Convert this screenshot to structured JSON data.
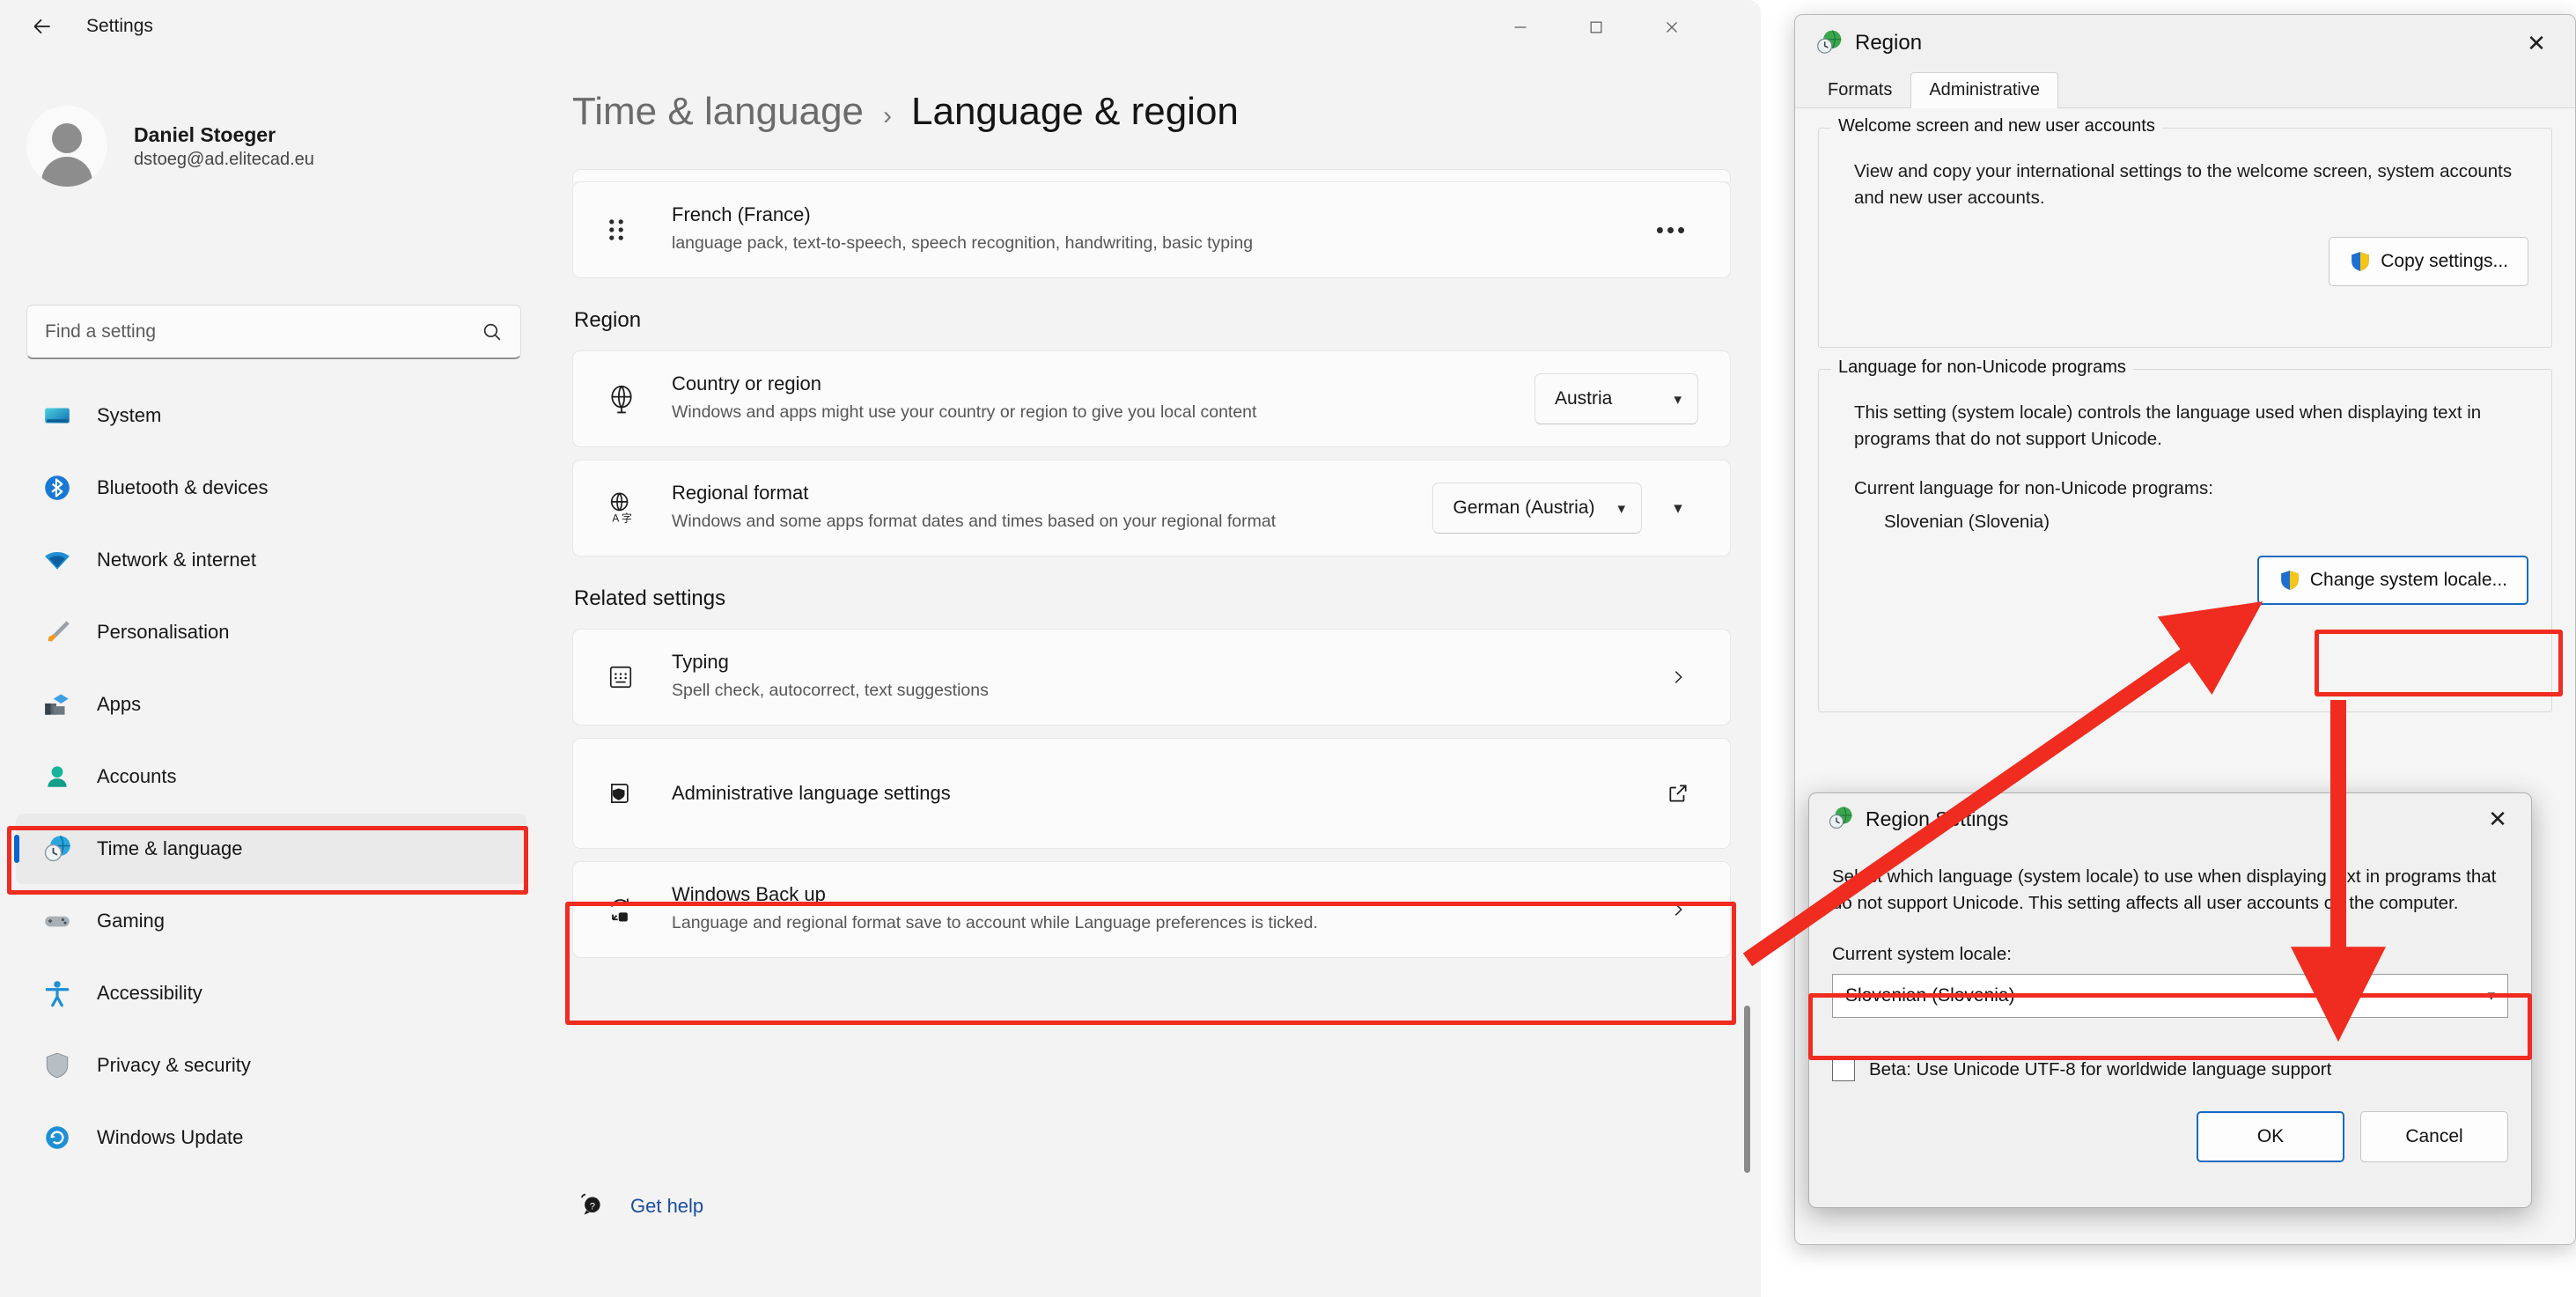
{
  "settings_window": {
    "title": "Settings",
    "back_icon": "back-arrow-icon",
    "window_controls": {
      "minimize": "–",
      "maximize": "□",
      "close": "✕"
    },
    "account": {
      "name": "Daniel Stoeger",
      "email": "dstoeg@ad.elitecad.eu"
    },
    "search": {
      "placeholder": "Find a setting",
      "icon": "search-icon"
    },
    "nav": [
      {
        "label": "System",
        "icon": "monitor-icon",
        "active": false
      },
      {
        "label": "Bluetooth & devices",
        "icon": "bluetooth-icon",
        "active": false
      },
      {
        "label": "Network & internet",
        "icon": "wifi-icon",
        "active": false
      },
      {
        "label": "Personalisation",
        "icon": "paintbrush-icon",
        "active": false
      },
      {
        "label": "Apps",
        "icon": "apps-icon",
        "active": false
      },
      {
        "label": "Accounts",
        "icon": "person-icon",
        "active": false
      },
      {
        "label": "Time & language",
        "icon": "clock-globe-icon",
        "active": true
      },
      {
        "label": "Gaming",
        "icon": "gamepad-icon",
        "active": false
      },
      {
        "label": "Accessibility",
        "icon": "accessibility-icon",
        "active": false
      },
      {
        "label": "Privacy & security",
        "icon": "shield-icon",
        "active": false
      },
      {
        "label": "Windows Update",
        "icon": "refresh-icon",
        "active": false
      }
    ],
    "breadcrumb": {
      "parent": "Time & language",
      "separator": "›",
      "current": "Language & region"
    },
    "language_row": {
      "name": "French (France)",
      "features": "language pack, text-to-speech, speech recognition, handwriting, basic typing",
      "drag_icon": "drag-handle-icon",
      "more_label": "•••"
    },
    "region_section": {
      "title": "Region",
      "country": {
        "title": "Country or region",
        "desc": "Windows and apps might use your country or region to give you local content",
        "icon": "globe-icon",
        "value": "Austria"
      },
      "regional_format": {
        "title": "Regional format",
        "desc": "Windows and some apps format dates and times based on your regional format",
        "icon": "globe-characters-icon",
        "value": "German (Austria)"
      }
    },
    "related_section": {
      "title": "Related settings",
      "items": [
        {
          "title": "Typing",
          "desc": "Spell check, autocorrect, text suggestions",
          "icon": "keyboard-icon",
          "affordance": "chevron-right-icon"
        },
        {
          "title": "Administrative language settings",
          "desc": "",
          "icon": "admin-shield-icon",
          "affordance": "open-external-icon"
        },
        {
          "title": "Windows Back up",
          "desc": "Language and regional format save to account while Language preferences is ticked.",
          "icon": "backup-icon",
          "affordance": "chevron-right-icon"
        }
      ]
    },
    "get_help": {
      "label": "Get help",
      "icon": "help-question-icon"
    }
  },
  "region_dialog": {
    "title": "Region",
    "icon": "region-clock-globe-icon",
    "close": "✕",
    "tabs": [
      {
        "label": "Formats",
        "active": false
      },
      {
        "label": "Administrative",
        "active": true
      }
    ],
    "welcome_group": {
      "legend": "Welcome screen and new user accounts",
      "text": "View and copy your international settings to the welcome screen, system accounts and new user accounts.",
      "button": "Copy settings...",
      "button_icon": "uac-shield-icon"
    },
    "nonunicode_group": {
      "legend": "Language for non-Unicode programs",
      "text": "This setting (system locale) controls the language used when displaying text in programs that do not support Unicode.",
      "current_label": "Current language for non-Unicode programs:",
      "current_value": "Slovenian (Slovenia)",
      "button": "Change system locale...",
      "button_icon": "uac-shield-icon"
    }
  },
  "region_settings_dialog": {
    "title": "Region Settings",
    "icon": "region-clock-globe-icon",
    "close": "✕",
    "description": "Select which language (system locale) to use when displaying text in programs that do not support Unicode. This setting affects all user accounts on the computer.",
    "locale_label": "Current system locale:",
    "locale_value": "Slovenian (Slovenia)",
    "beta_checkbox": {
      "label": "Beta: Use Unicode UTF-8 for worldwide language support",
      "checked": false
    },
    "ok_label": "OK",
    "cancel_label": "Cancel"
  },
  "annotations": {
    "highlight_color": "#f02b20",
    "boxes": [
      "sidebar-time-language",
      "administrative-language-settings",
      "change-system-locale-button",
      "current-system-locale-combo"
    ],
    "arrows": [
      "admin-settings-to-change-system-locale",
      "change-system-locale-to-locale-combo"
    ]
  }
}
